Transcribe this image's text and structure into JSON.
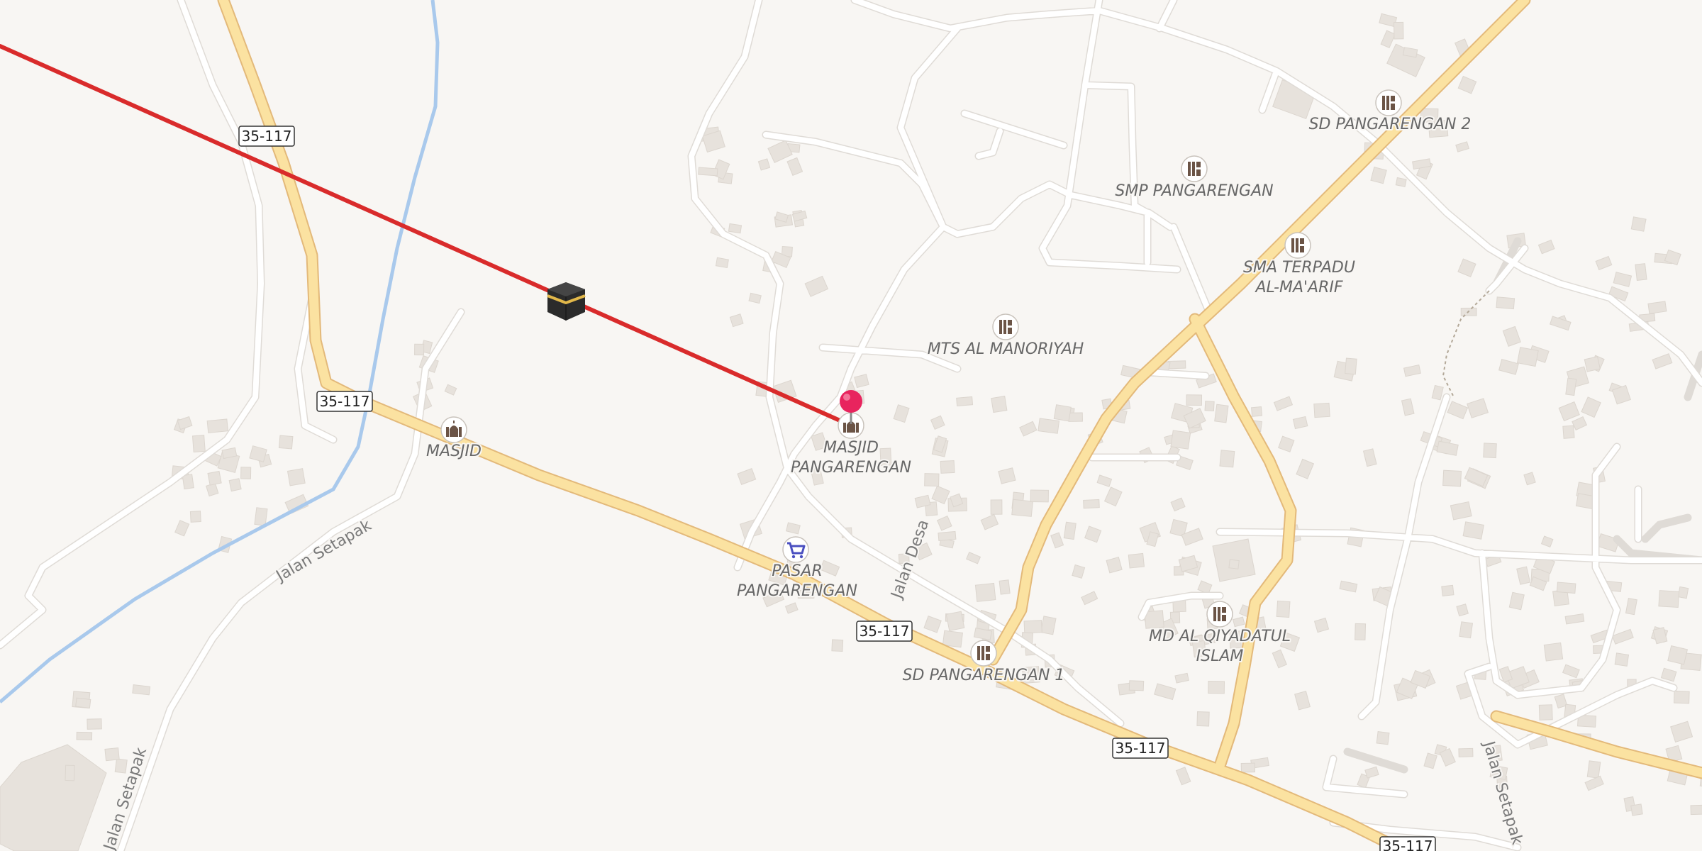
{
  "map": {
    "colors": {
      "land": "#f8f6f3",
      "building": "#e7e2dc",
      "minor_road": "#ffffff",
      "main_road": "#fbe2a1",
      "main_road_casing": "#e3b97a",
      "river": "#a9c9ec",
      "qibla_line": "#d92b2b",
      "pin": "#e8245e",
      "poi_icon": "#6b5446",
      "market_icon": "#4a4fc0"
    },
    "route_shields": {
      "s1": "35-117",
      "s2": "35-117",
      "s3": "35-117",
      "s4": "35-117",
      "s5": "35-117"
    },
    "streets": {
      "jalan_setapak_1": "Jalan Setapak",
      "jalan_setapak_2": "Jalan Setapak",
      "jalan_setapak_3": "Jalan Setapak",
      "jalan_desa": "Jalan Desa"
    },
    "pois": {
      "sd2": "SD PANGARENGAN 2",
      "smp": "SMP PANGARENGAN",
      "sma_l1": "SMA TERPADU",
      "sma_l2": "AL-MA'ARIF",
      "mts": "MTS AL MANORIYAH",
      "masjid": "MASJID",
      "masjid_p_l1": "MASJID",
      "masjid_p_l2": "PANGARENGAN",
      "pasar_l1": "PASAR",
      "pasar_l2": "PANGARENGAN",
      "md_l1": "MD AL QIYADATUL",
      "md_l2": "ISLAM",
      "sd1": "SD PANGARENGAN 1"
    },
    "icons": {
      "school": "school-icon",
      "mosque": "mosque-icon",
      "market": "shopping-cart-icon",
      "kaaba": "kaaba-icon",
      "pin": "location-pin-icon"
    }
  }
}
